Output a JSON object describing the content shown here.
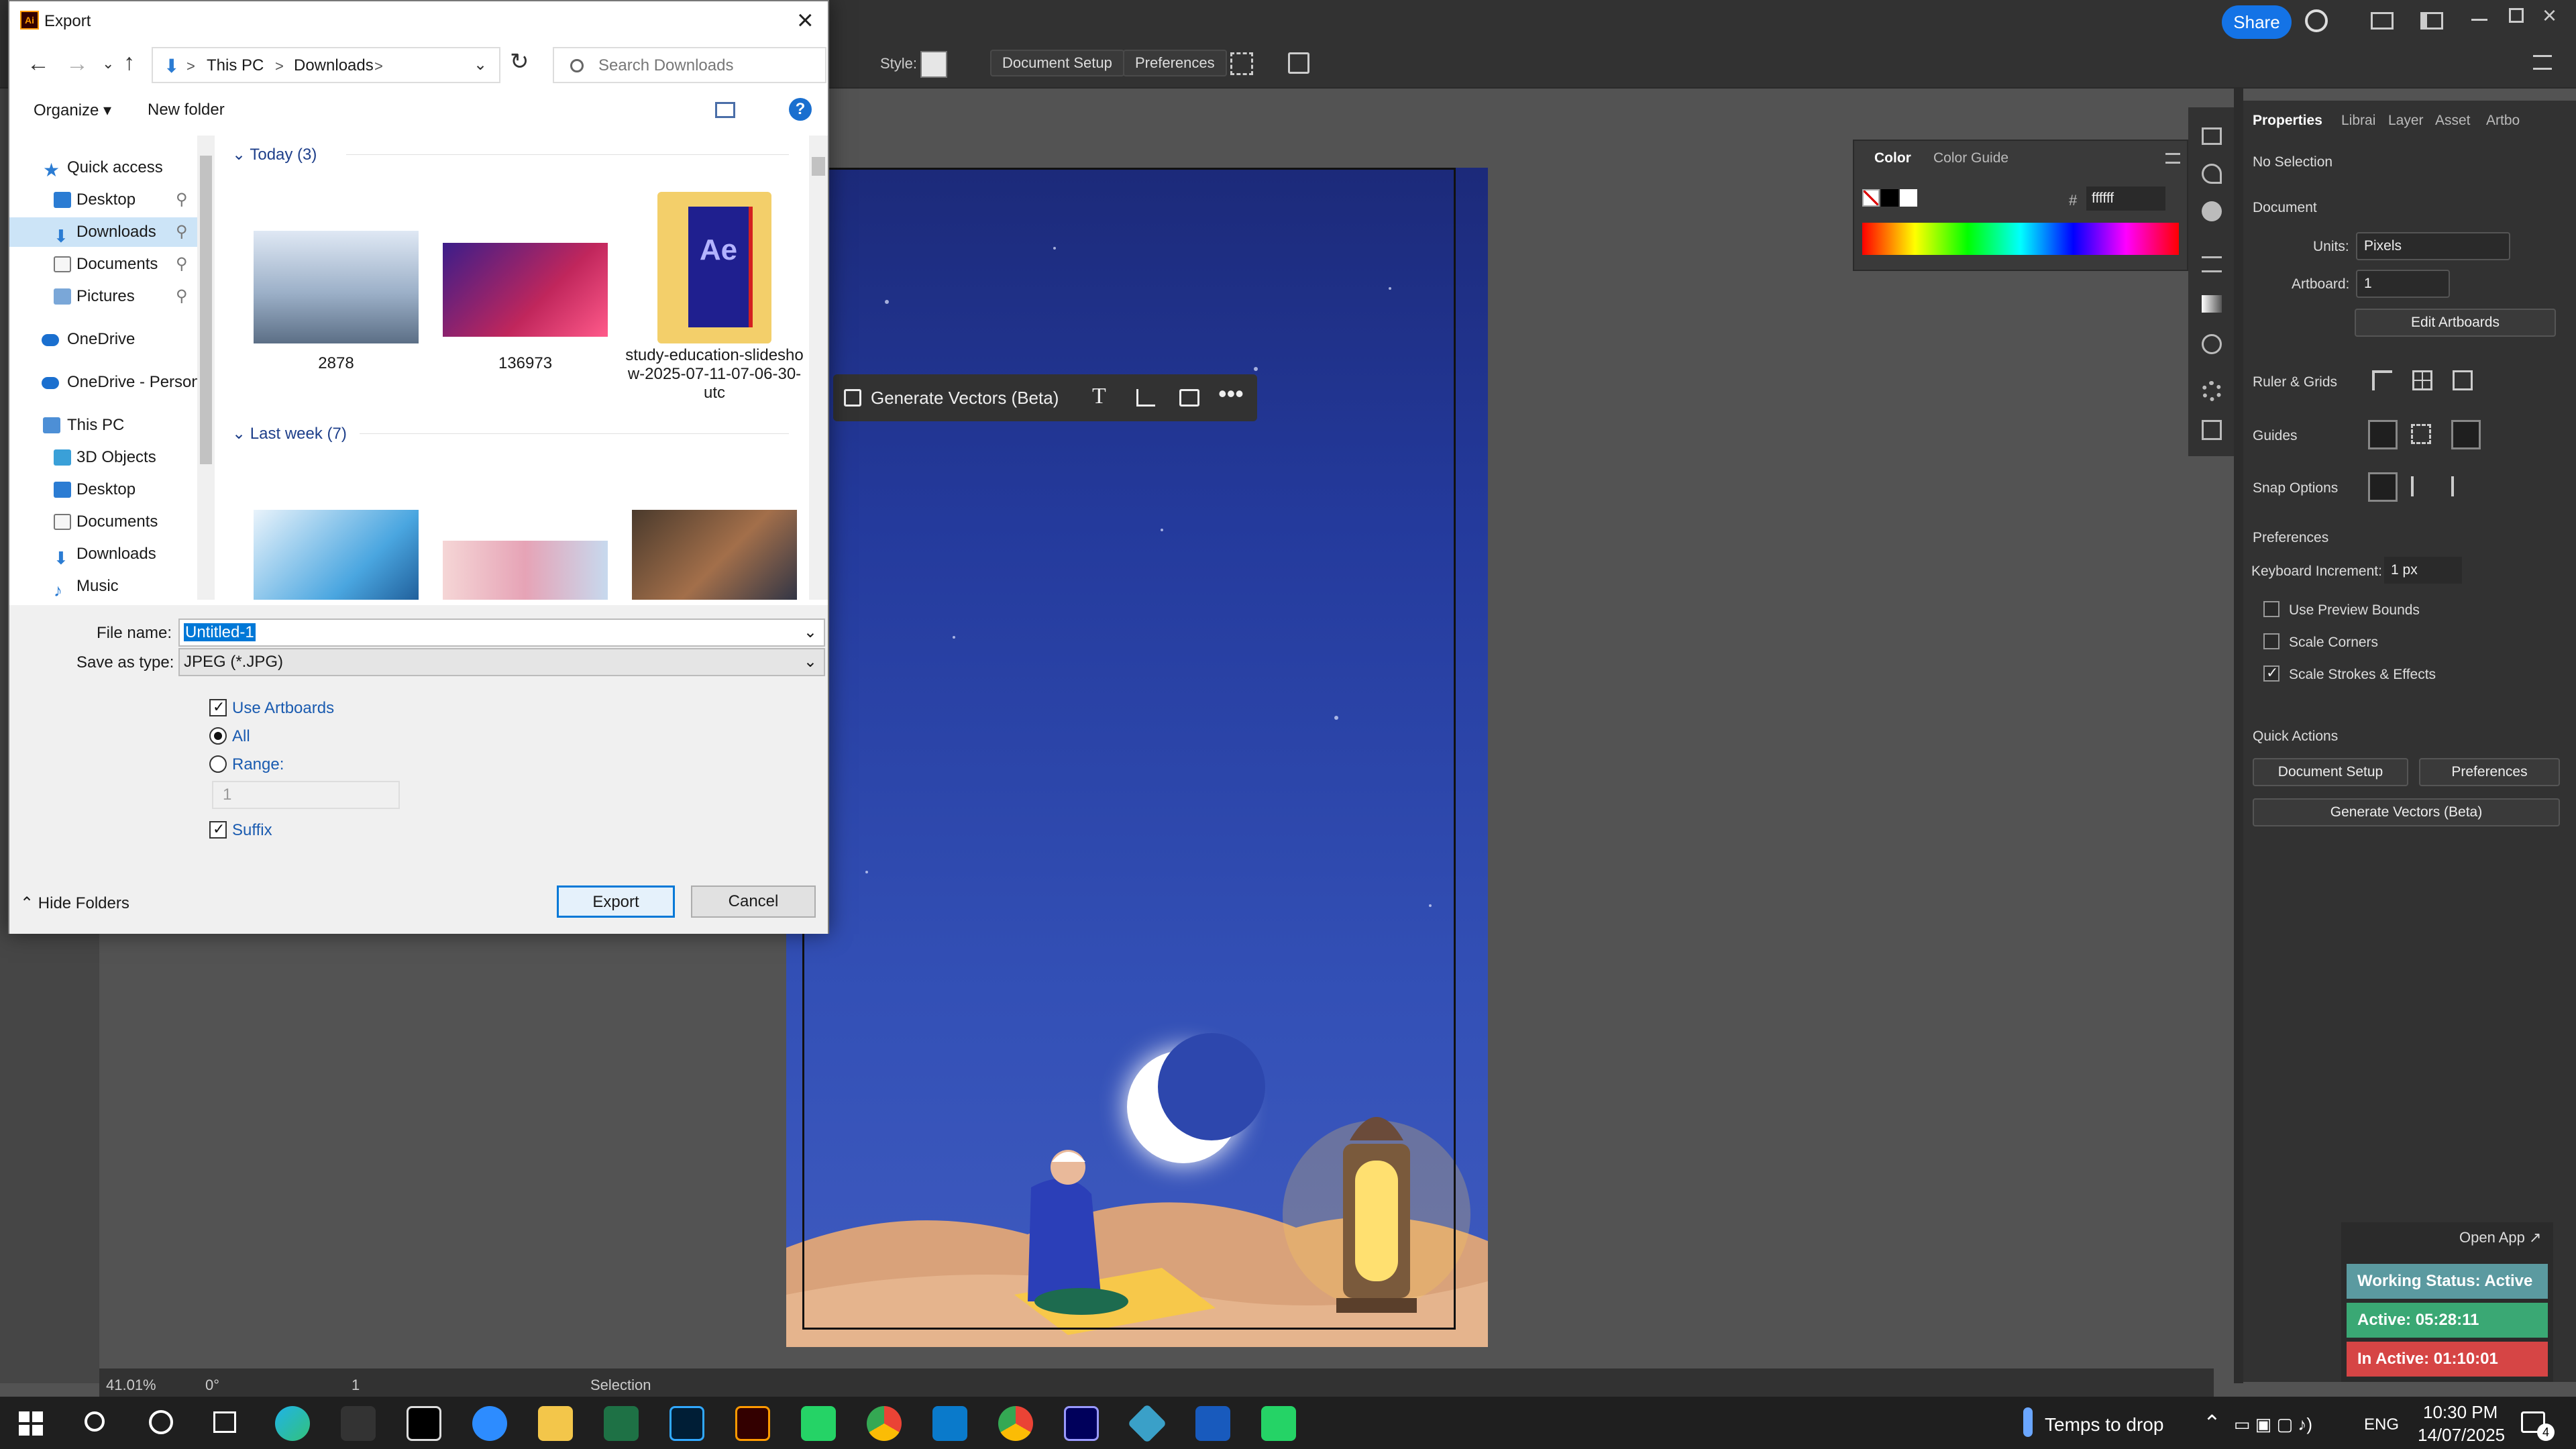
{
  "app": {
    "share_label": "Share",
    "style_label": "Style:",
    "document_setup_label": "Document Setup",
    "preferences_label": "Preferences",
    "context_bar": {
      "generate_vectors": "Generate Vectors (Beta)"
    }
  },
  "color_panel": {
    "tabs": [
      "Color",
      "Color Guide"
    ],
    "hex_symbol": "#",
    "hex_value": "ffffff"
  },
  "properties": {
    "tabs": [
      "Properties",
      "Librai",
      "Layer",
      "Asset",
      "Artbo"
    ],
    "no_selection": "No Selection",
    "document_heading": "Document",
    "units_label": "Units:",
    "units_value": "Pixels",
    "artboard_label": "Artboard:",
    "artboard_value": "1",
    "edit_artboards": "Edit Artboards",
    "ruler_grids": "Ruler & Grids",
    "guides": "Guides",
    "snap_options": "Snap Options",
    "preferences_heading": "Preferences",
    "keyboard_increment_label": "Keyboard Increment:",
    "keyboard_increment_value": "1 px",
    "use_preview_bounds": "Use Preview Bounds",
    "scale_corners": "Scale Corners",
    "scale_strokes": "Scale Strokes & Effects",
    "quick_actions": "Quick Actions",
    "qa_document_setup": "Document Setup",
    "qa_preferences": "Preferences",
    "qa_generate_vectors": "Generate Vectors (Beta)"
  },
  "timer_widget": {
    "open_app": "Open App ↗",
    "working_status": "Working Status: Active",
    "active": "Active: 05:28:11",
    "inactive": "In Active: 01:10:01",
    "colors": {
      "status": "#5b9aa0",
      "active": "#3aa874",
      "inactive": "#d64545"
    }
  },
  "status_bar": {
    "zoom": "41.01%",
    "rotation": "0°",
    "artboard_nav": "1",
    "tool": "Selection"
  },
  "taskbar": {
    "weather": "Temps to drop",
    "language": "ENG",
    "time": "10:30 PM",
    "date": "14/07/2025",
    "notifications": "4"
  },
  "dialog": {
    "title": "Export",
    "breadcrumb": [
      "This PC",
      "Downloads"
    ],
    "search_placeholder": "Search Downloads",
    "organize": "Organize ▾",
    "new_folder": "New folder",
    "nav_items": [
      {
        "label": "Quick access"
      },
      {
        "label": "Desktop"
      },
      {
        "label": "Downloads"
      },
      {
        "label": "Documents"
      },
      {
        "label": "Pictures"
      },
      {
        "label": "OneDrive"
      },
      {
        "label": "OneDrive - Person"
      },
      {
        "label": "This PC"
      },
      {
        "label": "3D Objects"
      },
      {
        "label": "Desktop"
      },
      {
        "label": "Documents"
      },
      {
        "label": "Downloads"
      },
      {
        "label": "Music"
      }
    ],
    "groups": {
      "today": "Today (3)",
      "last_week": "Last week (7)"
    },
    "files_today": [
      {
        "name": "2878"
      },
      {
        "name": "136973"
      },
      {
        "name": "study-education-slideshow-2025-07-11-07-06-30-utc"
      }
    ],
    "file_name_label": "File name:",
    "file_name_value": "Untitled-1",
    "save_type_label": "Save as type:",
    "save_type_value": "JPEG (*.JPG)",
    "use_artboards": "Use Artboards",
    "all": "All",
    "range": "Range:",
    "range_value": "1",
    "suffix": "Suffix",
    "hide_folders": "Hide Folders",
    "export_button": "Export",
    "cancel_button": "Cancel"
  }
}
